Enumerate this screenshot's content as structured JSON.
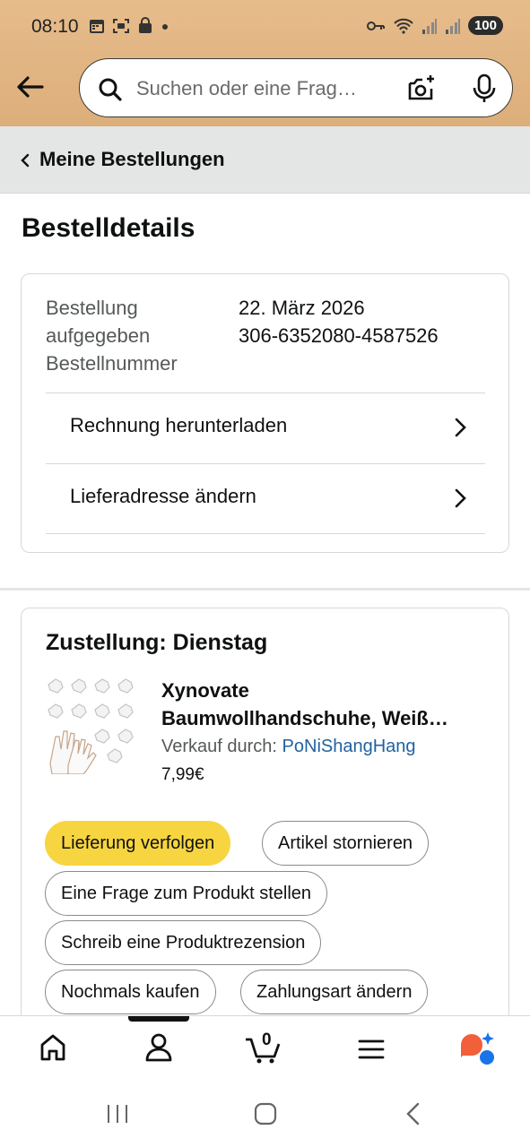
{
  "status_bar": {
    "time": "08:10",
    "battery": "100"
  },
  "search": {
    "placeholder": "Suchen oder eine Frag…"
  },
  "breadcrumb": {
    "label": "Meine Bestellungen"
  },
  "page": {
    "title": "Bestelldetails"
  },
  "order": {
    "labels": [
      "Bestellung",
      "aufgegeben",
      "Bestellnummer"
    ],
    "date": "22. März 2026",
    "number": "306-6352080-4587526",
    "links": [
      {
        "label": "Rechnung herunterladen"
      },
      {
        "label": "Lieferadresse ändern"
      }
    ]
  },
  "delivery": {
    "heading": "Zustellung: Dienstag",
    "product": {
      "name_line1": "Xynovate",
      "name_line2": "Baumwollhandschuhe, Weiß…",
      "seller_prefix": "Verkauf durch: ",
      "seller_name": "PoNiShangHang",
      "price": "7,99€"
    },
    "buttons": {
      "track": "Lieferung verfolgen",
      "cancel": "Artikel stornieren",
      "question": "Eine Frage zum Produkt stellen",
      "review": "Schreib eine Produktrezension",
      "buy_again": "Nochmals kaufen",
      "payment": "Zahlungsart ändern"
    }
  },
  "bottom_nav": {
    "cart_count": "0"
  },
  "colors": {
    "header": "#e7bc8b",
    "primary_button": "#f7d540",
    "link": "#2162a1",
    "breadcrumb_bg": "#e4e6e6"
  }
}
